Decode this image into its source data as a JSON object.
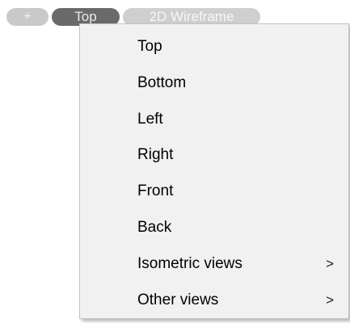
{
  "viewport_controls": {
    "plus_label": "+",
    "view_label": "Top",
    "style_label": "2D Wireframe"
  },
  "menu": {
    "items": [
      {
        "label": "Top",
        "submenu": false
      },
      {
        "label": "Bottom",
        "submenu": false
      },
      {
        "label": "Left",
        "submenu": false
      },
      {
        "label": "Right",
        "submenu": false
      },
      {
        "label": "Front",
        "submenu": false
      },
      {
        "label": "Back",
        "submenu": false
      },
      {
        "label": "Isometric views",
        "submenu": true,
        "arrow": ">"
      },
      {
        "label": "Other views",
        "submenu": true,
        "arrow": ">"
      }
    ]
  },
  "colors": {
    "menu_background": "#f1f1f1",
    "active_pill": "#6a6a6a",
    "inactive_pill": "#cfcfcf"
  }
}
